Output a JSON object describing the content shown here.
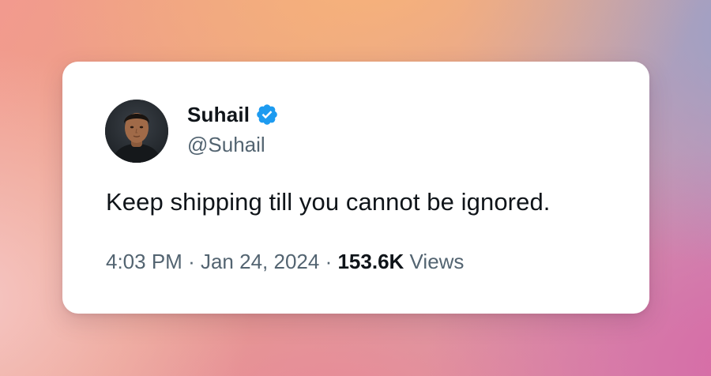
{
  "tweet": {
    "author": {
      "display_name": "Suhail",
      "handle": "@Suhail",
      "verified": true,
      "avatar_icon": "avatar-photo",
      "verified_icon": "verified-badge-icon",
      "verified_color": "#1d9bf0"
    },
    "text": "Keep shipping till you cannot be ignored.",
    "time": "4:03 PM",
    "separator": "·",
    "date": "Jan 24, 2024",
    "views_count": "153.6K",
    "views_label": "Views"
  },
  "colors": {
    "text_primary": "#0f1419",
    "text_secondary": "#536471",
    "card_background": "#ffffff"
  }
}
